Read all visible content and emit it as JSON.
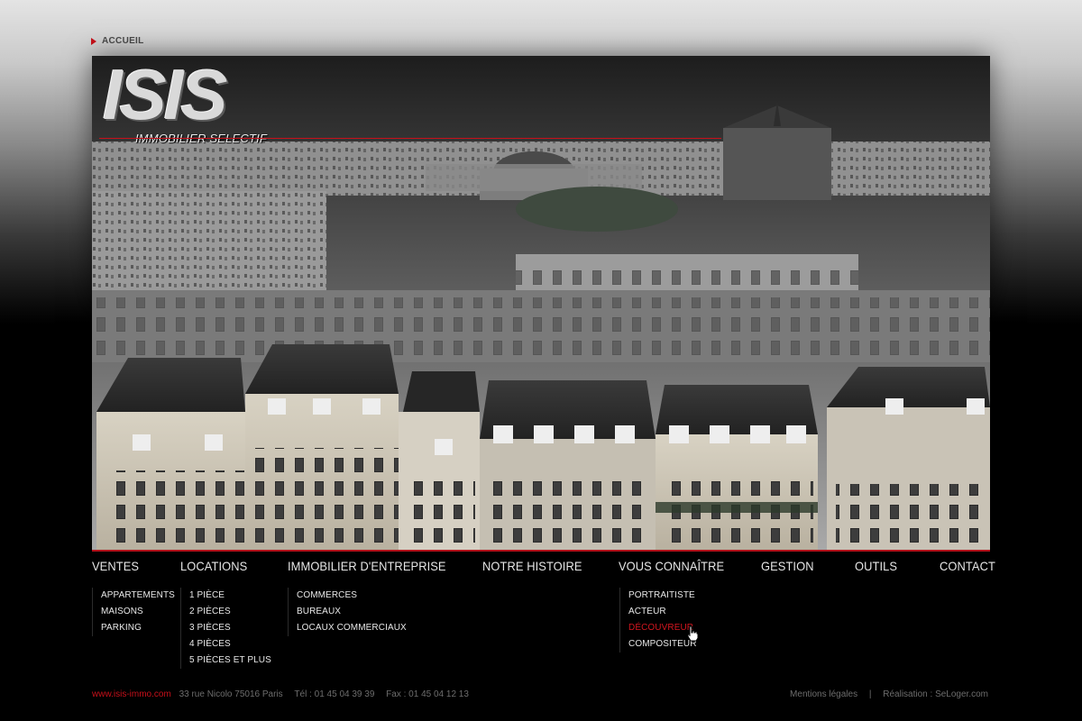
{
  "breadcrumb": {
    "label": "ACCUEIL"
  },
  "logo": {
    "title": "ISIS",
    "subtitle": "IMMOBILIER SELECTIF"
  },
  "nav": [
    {
      "label": "VENTES"
    },
    {
      "label": "LOCATIONS"
    },
    {
      "label": "IMMOBILIER D'ENTREPRISE"
    },
    {
      "label": "NOTRE HISTOIRE"
    },
    {
      "label": "VOUS CONNAÎTRE"
    },
    {
      "label": "GESTION"
    },
    {
      "label": "OUTILS"
    },
    {
      "label": "CONTACT"
    }
  ],
  "submenus": {
    "ventes": [
      "APPARTEMENTS",
      "MAISONS",
      "PARKING"
    ],
    "locations": [
      "1 PIÈCE",
      "2 PIÈCES",
      "3 PIÈCES",
      "4 PIÈCES",
      "5 PIÈCES ET PLUS"
    ],
    "entreprise": [
      "COMMERCES",
      "BUREAUX",
      "LOCAUX COMMERCIAUX"
    ],
    "vous_connaitre": [
      "PORTRAITISTE",
      "ACTEUR",
      "DÉCOUVREUR",
      "COMPOSITEUR"
    ]
  },
  "footer": {
    "site": "www.isis-immo.com",
    "address": "33 rue Nicolo 75016 Paris",
    "tel": "Tél : 01 45 04 39 39",
    "fax": "Fax : 01 45 04 12 13",
    "legal": "Mentions légales",
    "separator": "|",
    "credit": "Réalisation : SeLoger.com"
  },
  "colors": {
    "accent": "#c8101a",
    "background": "#000000",
    "text": "#e6e6e6"
  }
}
